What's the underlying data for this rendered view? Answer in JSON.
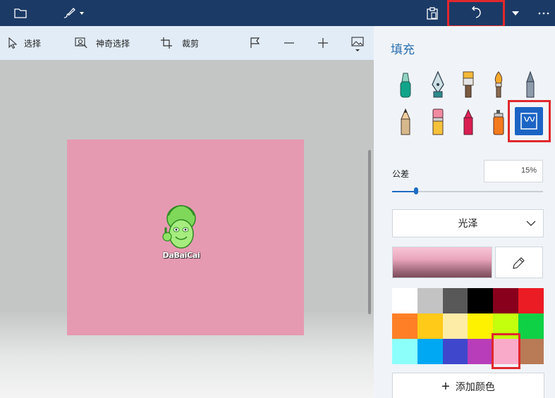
{
  "titlebar": {
    "icons": [
      "folder-icon",
      "brush-menu-icon",
      "paste-icon",
      "undo-icon",
      "more-icon"
    ]
  },
  "toolbar": {
    "select_label": "选择",
    "magic_select_label": "神奇选择",
    "crop_label": "裁剪"
  },
  "panel": {
    "title": "填充",
    "tolerance_label": "公差",
    "tolerance_value": "15%",
    "tolerance_fraction": 0.15,
    "finish_selected": "光泽",
    "add_color_label": "添加颜色",
    "current_color": "#e69ab2",
    "selected_swatch": "#f9aac8",
    "palette": [
      "#ffffff",
      "#c3c3c3",
      "#585858",
      "#000000",
      "#88001b",
      "#ec1c24",
      "#ff7f27",
      "#ffca18",
      "#fdeca6",
      "#fff200",
      "#c4ff0e",
      "#0ed145",
      "#8cfffb",
      "#00a8f3",
      "#3f48cc",
      "#b83dba",
      "#f9aac8",
      "#b97a56"
    ]
  },
  "canvas": {
    "background": "#e69ab2",
    "logo_text": "DaBaiCai"
  },
  "colors": {
    "titlebar": "#1b3a66",
    "accent": "#1c64c4",
    "highlight": "#e0282d"
  }
}
